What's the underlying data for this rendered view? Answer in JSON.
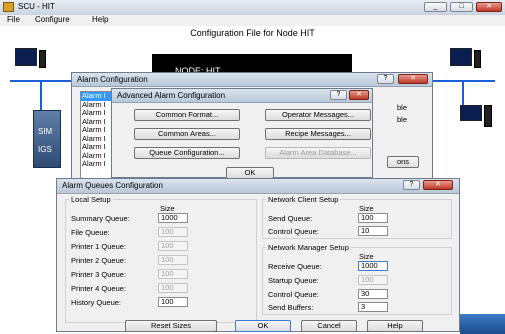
{
  "window": {
    "title": "SCU - HIT",
    "buttons": [
      "_",
      "□",
      "✕"
    ]
  },
  "menu": [
    "File",
    "Configure",
    "Help"
  ],
  "heading": "Configuration File for Node HIT",
  "node_label": "NODE: HIT",
  "sim_box": {
    "labels": [
      "SIM",
      "IGS"
    ]
  },
  "alarm_config": {
    "title": "Alarm Configuration",
    "list_items": [
      "Alarm I",
      "Alarm I",
      "Alarm I",
      "Alarm I",
      "Alarm I",
      "Alarm I",
      "Alarm I",
      "Alarm I",
      "Alarm I"
    ],
    "right_text": [
      "ble",
      "ble"
    ],
    "right_button": "ons"
  },
  "advanced": {
    "title": "Advanced Alarm Configuration",
    "buttons": {
      "common_format": "Common Format...",
      "operator_messages": "Operator Messages...",
      "common_areas": "Common Areas...",
      "recipe_messages": "Recipe Messages...",
      "queue_configuration": "Queue Configuration...",
      "alarm_area_database": "Alarm Area Database..."
    },
    "ok": "OK"
  },
  "queues": {
    "title": "Alarm Queues Configuration",
    "local_setup": {
      "label": "Local Setup",
      "size_header": "Size",
      "rows": [
        {
          "label": "Summary Queue:",
          "value": "1000",
          "enabled": true
        },
        {
          "label": "File Queue:",
          "value": "100",
          "enabled": false
        },
        {
          "label": "Printer 1 Queue:",
          "value": "100",
          "enabled": false
        },
        {
          "label": "Printer 2 Queue:",
          "value": "100",
          "enabled": false
        },
        {
          "label": "Printer 3 Queue:",
          "value": "100",
          "enabled": false
        },
        {
          "label": "Printer 4 Queue:",
          "value": "100",
          "enabled": false
        },
        {
          "label": "History Queue:",
          "value": "100",
          "enabled": true
        }
      ]
    },
    "client_setup": {
      "label": "Network Client Setup",
      "size_header": "Size",
      "rows": [
        {
          "label": "Send Queue:",
          "value": "100",
          "enabled": true
        },
        {
          "label": "Control Queue:",
          "value": "10",
          "enabled": true
        }
      ]
    },
    "manager_setup": {
      "label": "Network Manager Setup",
      "size_header": "Size",
      "rows": [
        {
          "label": "Receive Queue:",
          "value": "1000",
          "enabled": true
        },
        {
          "label": "Startup Queue:",
          "value": "100",
          "enabled": false
        },
        {
          "label": "Control Queue:",
          "value": "30",
          "enabled": true
        },
        {
          "label": "Send Buffers:",
          "value": "3",
          "enabled": true
        }
      ]
    },
    "buttons": {
      "reset": "Reset Sizes",
      "ok": "OK",
      "cancel": "Cancel",
      "help": "Help"
    }
  }
}
